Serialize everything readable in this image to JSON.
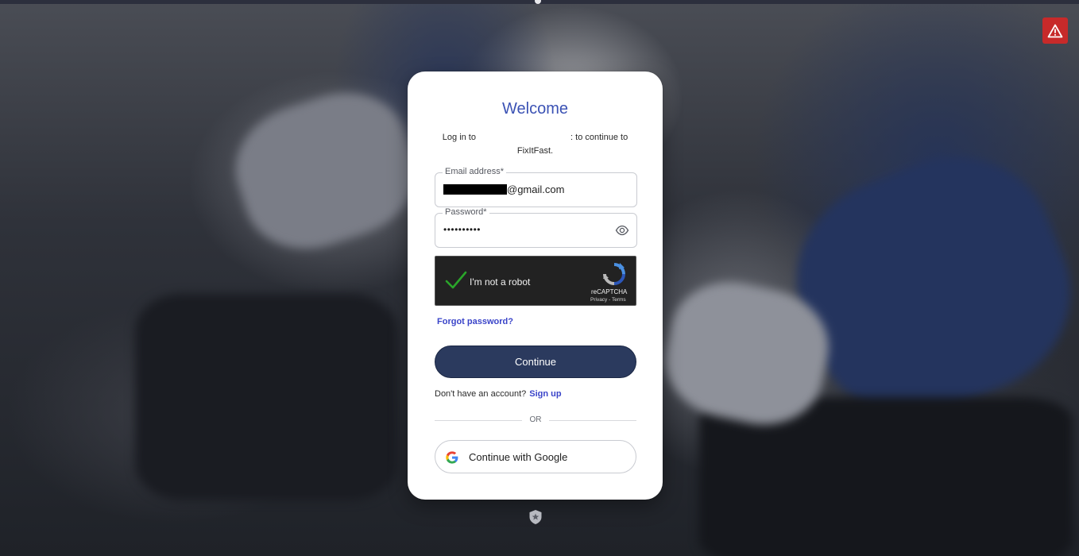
{
  "login": {
    "title": "Welcome",
    "subtitle_prefix": "Log in to",
    "subtitle_suffix": ": to continue to",
    "app_name": "FixItFast.",
    "email": {
      "label": "Email address*",
      "value_suffix": "@gmail.com"
    },
    "password": {
      "label": "Password*",
      "masked_value": "••••••••••"
    },
    "captcha": {
      "label": "I'm not a robot",
      "brand": "reCAPTCHA",
      "links": "Privacy - Terms",
      "checked": true
    },
    "forgot_password": "Forgot password?",
    "continue_button": "Continue",
    "signup_prompt": "Don't have an account?",
    "signup_link": "Sign up",
    "divider": "OR",
    "google_button": "Continue with Google"
  },
  "icons": {
    "alert": "warning-triangle-icon",
    "password_toggle": "eye-icon",
    "captcha_check": "checkmark-icon",
    "captcha_logo": "recaptcha-icon",
    "google": "google-icon",
    "footer": "shield-star-icon"
  },
  "colors": {
    "accent": "#3b52b4",
    "link": "#3a44c9",
    "primary_button": "#2b3a5e",
    "alert": "#c72a2a"
  }
}
